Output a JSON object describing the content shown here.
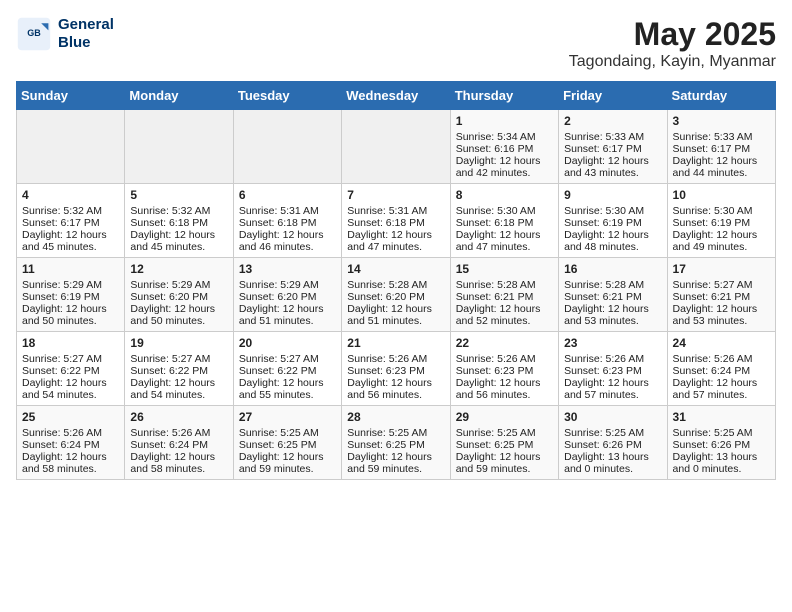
{
  "header": {
    "logo_line1": "General",
    "logo_line2": "Blue",
    "month_title": "May 2025",
    "location": "Tagondaing, Kayin, Myanmar"
  },
  "weekdays": [
    "Sunday",
    "Monday",
    "Tuesday",
    "Wednesday",
    "Thursday",
    "Friday",
    "Saturday"
  ],
  "weeks": [
    [
      {
        "day": "",
        "info": ""
      },
      {
        "day": "",
        "info": ""
      },
      {
        "day": "",
        "info": ""
      },
      {
        "day": "",
        "info": ""
      },
      {
        "day": "1",
        "info": "Sunrise: 5:34 AM\nSunset: 6:16 PM\nDaylight: 12 hours\nand 42 minutes."
      },
      {
        "day": "2",
        "info": "Sunrise: 5:33 AM\nSunset: 6:17 PM\nDaylight: 12 hours\nand 43 minutes."
      },
      {
        "day": "3",
        "info": "Sunrise: 5:33 AM\nSunset: 6:17 PM\nDaylight: 12 hours\nand 44 minutes."
      }
    ],
    [
      {
        "day": "4",
        "info": "Sunrise: 5:32 AM\nSunset: 6:17 PM\nDaylight: 12 hours\nand 45 minutes."
      },
      {
        "day": "5",
        "info": "Sunrise: 5:32 AM\nSunset: 6:18 PM\nDaylight: 12 hours\nand 45 minutes."
      },
      {
        "day": "6",
        "info": "Sunrise: 5:31 AM\nSunset: 6:18 PM\nDaylight: 12 hours\nand 46 minutes."
      },
      {
        "day": "7",
        "info": "Sunrise: 5:31 AM\nSunset: 6:18 PM\nDaylight: 12 hours\nand 47 minutes."
      },
      {
        "day": "8",
        "info": "Sunrise: 5:30 AM\nSunset: 6:18 PM\nDaylight: 12 hours\nand 47 minutes."
      },
      {
        "day": "9",
        "info": "Sunrise: 5:30 AM\nSunset: 6:19 PM\nDaylight: 12 hours\nand 48 minutes."
      },
      {
        "day": "10",
        "info": "Sunrise: 5:30 AM\nSunset: 6:19 PM\nDaylight: 12 hours\nand 49 minutes."
      }
    ],
    [
      {
        "day": "11",
        "info": "Sunrise: 5:29 AM\nSunset: 6:19 PM\nDaylight: 12 hours\nand 50 minutes."
      },
      {
        "day": "12",
        "info": "Sunrise: 5:29 AM\nSunset: 6:20 PM\nDaylight: 12 hours\nand 50 minutes."
      },
      {
        "day": "13",
        "info": "Sunrise: 5:29 AM\nSunset: 6:20 PM\nDaylight: 12 hours\nand 51 minutes."
      },
      {
        "day": "14",
        "info": "Sunrise: 5:28 AM\nSunset: 6:20 PM\nDaylight: 12 hours\nand 51 minutes."
      },
      {
        "day": "15",
        "info": "Sunrise: 5:28 AM\nSunset: 6:21 PM\nDaylight: 12 hours\nand 52 minutes."
      },
      {
        "day": "16",
        "info": "Sunrise: 5:28 AM\nSunset: 6:21 PM\nDaylight: 12 hours\nand 53 minutes."
      },
      {
        "day": "17",
        "info": "Sunrise: 5:27 AM\nSunset: 6:21 PM\nDaylight: 12 hours\nand 53 minutes."
      }
    ],
    [
      {
        "day": "18",
        "info": "Sunrise: 5:27 AM\nSunset: 6:22 PM\nDaylight: 12 hours\nand 54 minutes."
      },
      {
        "day": "19",
        "info": "Sunrise: 5:27 AM\nSunset: 6:22 PM\nDaylight: 12 hours\nand 54 minutes."
      },
      {
        "day": "20",
        "info": "Sunrise: 5:27 AM\nSunset: 6:22 PM\nDaylight: 12 hours\nand 55 minutes."
      },
      {
        "day": "21",
        "info": "Sunrise: 5:26 AM\nSunset: 6:23 PM\nDaylight: 12 hours\nand 56 minutes."
      },
      {
        "day": "22",
        "info": "Sunrise: 5:26 AM\nSunset: 6:23 PM\nDaylight: 12 hours\nand 56 minutes."
      },
      {
        "day": "23",
        "info": "Sunrise: 5:26 AM\nSunset: 6:23 PM\nDaylight: 12 hours\nand 57 minutes."
      },
      {
        "day": "24",
        "info": "Sunrise: 5:26 AM\nSunset: 6:24 PM\nDaylight: 12 hours\nand 57 minutes."
      }
    ],
    [
      {
        "day": "25",
        "info": "Sunrise: 5:26 AM\nSunset: 6:24 PM\nDaylight: 12 hours\nand 58 minutes."
      },
      {
        "day": "26",
        "info": "Sunrise: 5:26 AM\nSunset: 6:24 PM\nDaylight: 12 hours\nand 58 minutes."
      },
      {
        "day": "27",
        "info": "Sunrise: 5:25 AM\nSunset: 6:25 PM\nDaylight: 12 hours\nand 59 minutes."
      },
      {
        "day": "28",
        "info": "Sunrise: 5:25 AM\nSunset: 6:25 PM\nDaylight: 12 hours\nand 59 minutes."
      },
      {
        "day": "29",
        "info": "Sunrise: 5:25 AM\nSunset: 6:25 PM\nDaylight: 12 hours\nand 59 minutes."
      },
      {
        "day": "30",
        "info": "Sunrise: 5:25 AM\nSunset: 6:26 PM\nDaylight: 13 hours\nand 0 minutes."
      },
      {
        "day": "31",
        "info": "Sunrise: 5:25 AM\nSunset: 6:26 PM\nDaylight: 13 hours\nand 0 minutes."
      }
    ]
  ]
}
